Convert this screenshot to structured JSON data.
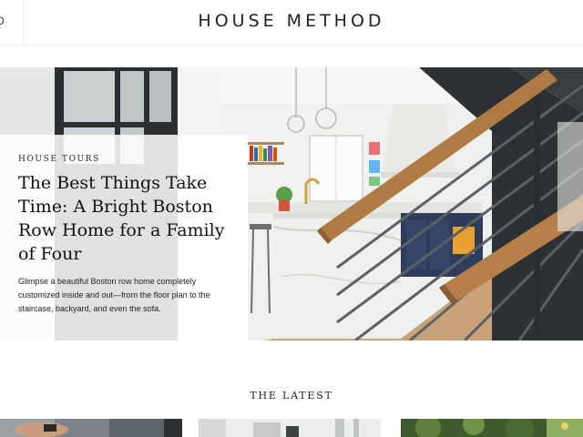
{
  "header": {
    "logo": "HOUSE METHOD",
    "left_fragment": "D"
  },
  "hero": {
    "kicker": "HOUSE TOURS",
    "title": "The Best Things Take Time: A Bright Boston Row Home for a Family of Four",
    "description": "Glimpse a beautiful Boston row home completely customized inside and out—from the floor plan to the staircase, backyard, and even the sofa."
  },
  "latest": {
    "heading": "THE LATEST"
  }
}
